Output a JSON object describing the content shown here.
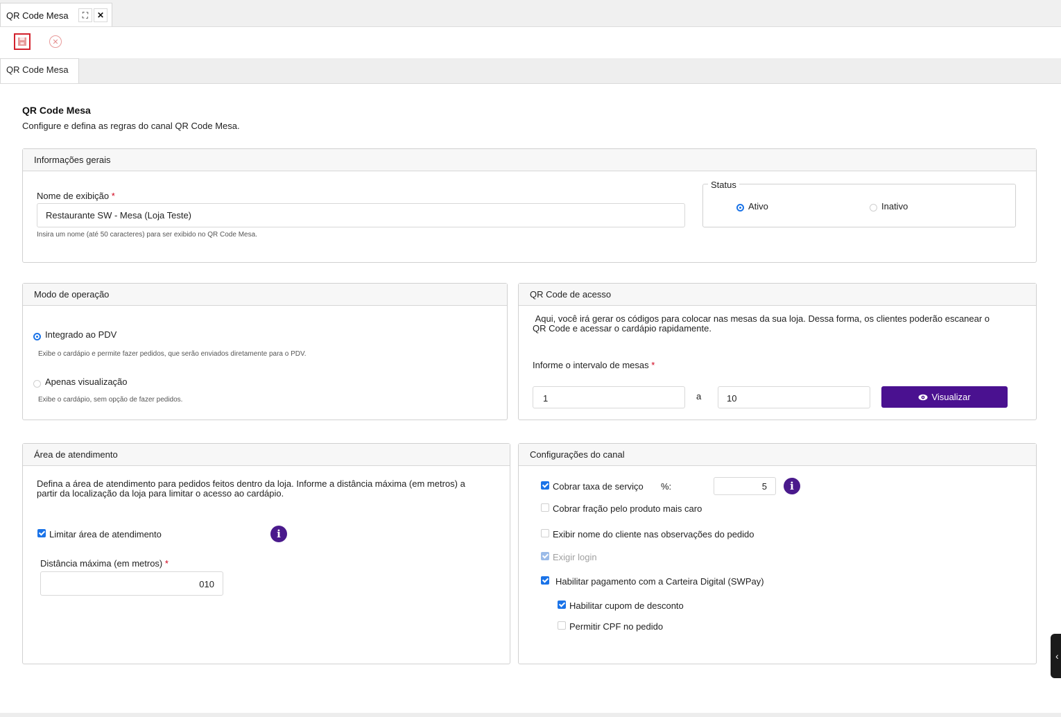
{
  "window": {
    "tab_title": "QR Code Mesa",
    "maximize_icon": "expand-icon",
    "close_icon": "close-icon"
  },
  "toolbar": {
    "save_icon": "save-icon",
    "cancel_icon": "cancel-icon"
  },
  "subtabs": [
    {
      "label": "QR Code Mesa"
    }
  ],
  "page": {
    "title": "QR Code Mesa",
    "subtitle": "Configure e defina as regras do canal QR Code Mesa."
  },
  "general": {
    "header": "Informações gerais",
    "name_label": "Nome de exibição",
    "required_mark": "*",
    "name_value": "Restaurante SW - Mesa (Loja Teste)",
    "name_help": "Insira um nome (até 50 caracteres) para ser exibido no QR Code Mesa.",
    "status_legend": "Status",
    "status_active": "Ativo",
    "status_inactive": "Inativo"
  },
  "mode": {
    "header": "Modo de operação",
    "option1": "Integrado ao PDV",
    "option1_help": "Exibe o cardápio e permite fazer pedidos, que serão enviados diretamente para o PDV.",
    "option2": "Apenas visualização",
    "option2_help": "Exibe o cardápio, sem opção de fazer pedidos."
  },
  "qr": {
    "header": "QR Code de acesso",
    "description": " Aqui, você irá gerar os códigos para colocar nas mesas da sua loja. Dessa forma, os clientes poderão escanear o QR Code e acessar o cardápio rapidamente.",
    "interval_label": "Informe o intervalo de mesas",
    "from_value": "1",
    "separator": "a",
    "to_value": "10",
    "view_button": "Visualizar",
    "view_icon": "eye-icon"
  },
  "area": {
    "header": "Área de atendimento",
    "description": "Defina a área de atendimento para pedidos feitos dentro da loja. Informe a distância máxima (em metros) a partir da localização da loja para limitar o acesso ao cardápio.",
    "limit_label": "Limitar área de atendimento",
    "distance_label": "Distância máxima (em metros)",
    "distance_value": "010"
  },
  "channel": {
    "header": "Configurações do canal",
    "service_fee_label": "Cobrar taxa de serviço",
    "percent_label": "%:",
    "percent_value": "5",
    "fraction_label": "Cobrar fração pelo produto mais caro",
    "show_name_label": "Exibir nome do cliente nas observações do pedido",
    "require_login_label": "Exigir login",
    "wallet_label": "Habilitar pagamento com a Carteira Digital (SWPay)",
    "coupon_label": "Habilitar cupom de desconto",
    "cpf_label": "Permitir CPF no pedido"
  },
  "colors": {
    "accent": "#4a1190",
    "checkbox": "#1a73e8",
    "danger": "#d3212d"
  }
}
